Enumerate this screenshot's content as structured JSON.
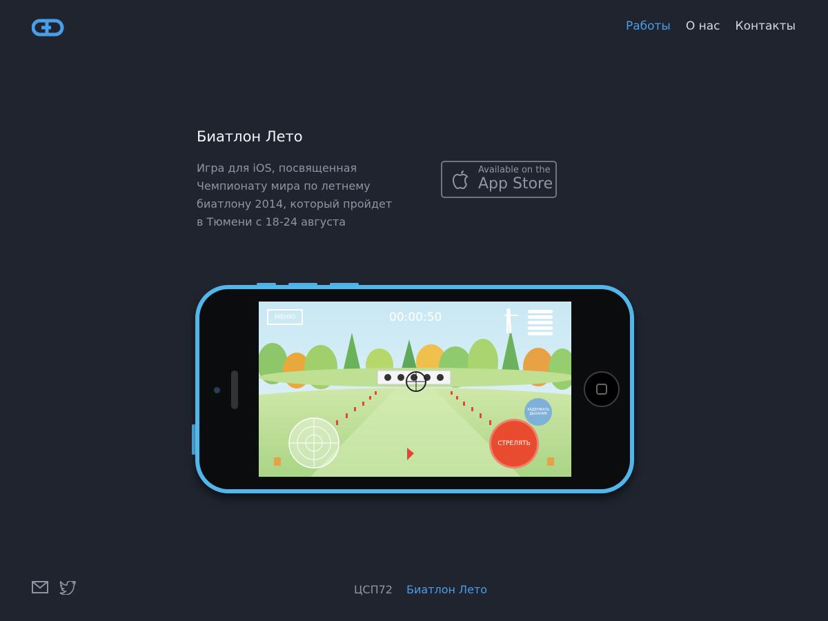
{
  "header": {
    "logo_icon": "cd-link-logo",
    "nav": [
      {
        "label": "Работы",
        "active": true
      },
      {
        "label": "О нас",
        "active": false
      },
      {
        "label": "Контакты",
        "active": false
      }
    ]
  },
  "project": {
    "title": "Биатлон Лето",
    "description": "Игра для iOS, посвященная Чемпионату мира по летнему биатлону 2014, который пройдет в Тюмени с 18-24 августа",
    "app_store": {
      "small": "Available on the",
      "big": "App Store"
    }
  },
  "game_screen": {
    "menu_label": "МЕНЮ",
    "timer": "00:00:50",
    "shoot_label": "СТРЕЛЯТЬ",
    "breath_label": "ЗАДЕРЖАТЬ ДЫХАНИЕ",
    "targets_remaining": 5,
    "bullets": 5
  },
  "footer": {
    "icons": [
      "mail-icon",
      "twitter-icon"
    ],
    "breadcrumb": [
      {
        "label": "ЦСП72"
      },
      {
        "label": "Биатлон Лето"
      }
    ]
  },
  "colors": {
    "background": "#1f242e",
    "accent": "#4a9ee8",
    "phone_body": "#52b6ea"
  }
}
